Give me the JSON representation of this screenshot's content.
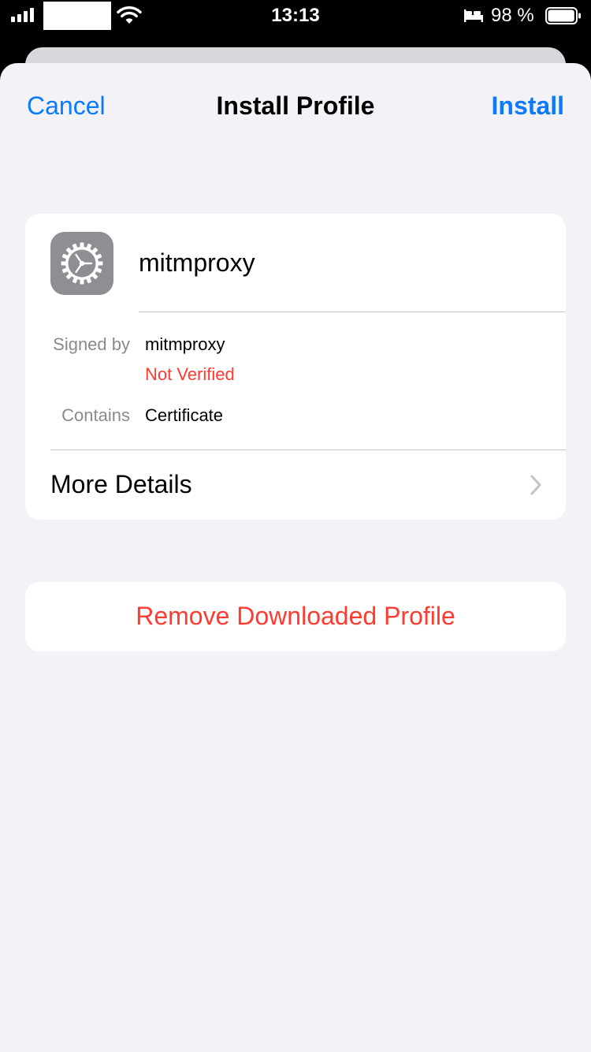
{
  "status_bar": {
    "time": "13:13",
    "battery_percent": "98 %",
    "signal_icon": "cellular-signal-icon",
    "wifi_icon": "wifi-icon",
    "sleep_icon": "bed-icon",
    "battery_icon": "battery-icon",
    "battery_level": 0.98
  },
  "nav": {
    "cancel_label": "Cancel",
    "title": "Install Profile",
    "install_label": "Install"
  },
  "profile": {
    "icon": "gear-icon",
    "name": "mitmproxy",
    "signed_by_label": "Signed by",
    "signed_by_value": "mitmproxy",
    "verification_status": "Not Verified",
    "contains_label": "Contains",
    "contains_value": "Certificate",
    "more_details_label": "More Details",
    "more_details_icon": "chevron-right-icon"
  },
  "actions": {
    "remove_label": "Remove Downloaded Profile"
  },
  "colors": {
    "accent": "#0a7aff",
    "destructive": "#ff3b30",
    "background": "#f2f2f7",
    "secondary_text": "#8a8a8e",
    "icon_background": "#8e8e93"
  }
}
